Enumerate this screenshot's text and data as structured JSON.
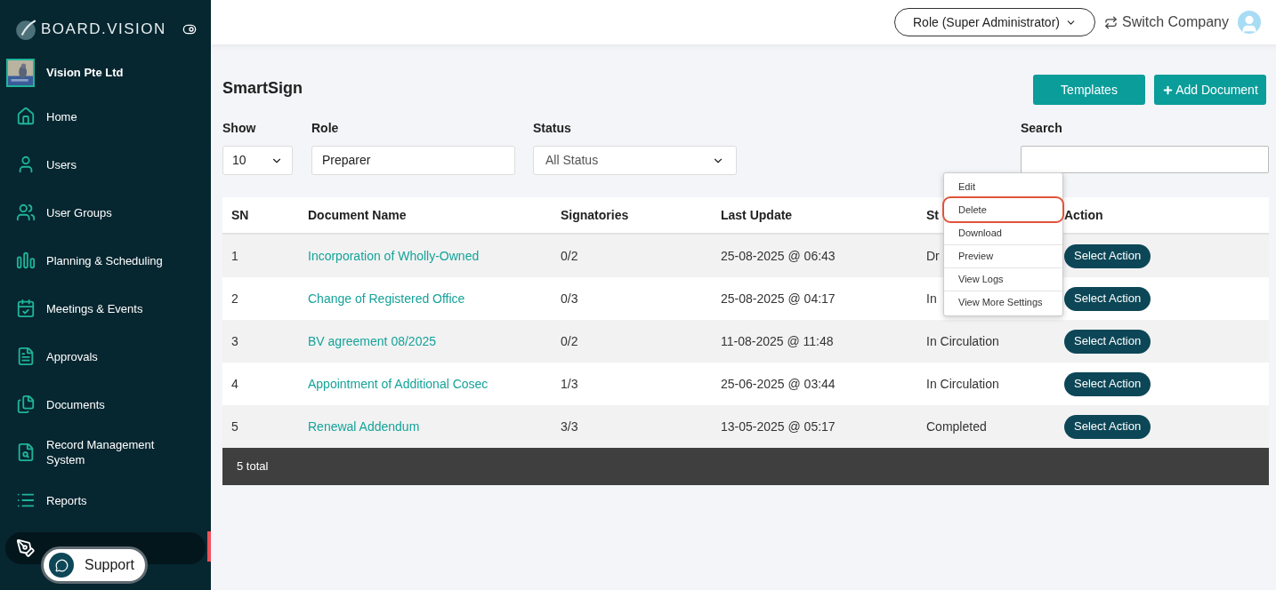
{
  "brand": {
    "name": "BOARD.VISION"
  },
  "company": {
    "name": "Vision Pte Ltd"
  },
  "sidebar": {
    "items": [
      {
        "kind": "home",
        "label": "Home",
        "selected": false
      },
      {
        "kind": "user",
        "label": "Users",
        "selected": false
      },
      {
        "kind": "users",
        "label": "User Groups",
        "selected": false
      },
      {
        "kind": "bars",
        "label": "Planning & Scheduling",
        "selected": false
      },
      {
        "kind": "calendar",
        "label": "Meetings & Events",
        "selected": false
      },
      {
        "kind": "file",
        "label": "Approvals",
        "selected": false
      },
      {
        "kind": "files",
        "label": "Documents",
        "selected": false
      },
      {
        "kind": "record",
        "label": "Record Management System",
        "selected": false
      },
      {
        "kind": "list",
        "label": "Reports",
        "selected": false
      },
      {
        "kind": "pen",
        "selected": true
      }
    ]
  },
  "support": {
    "label": "Support"
  },
  "header": {
    "role": "Role (Super Administrator)",
    "switch": "Switch Company"
  },
  "page": {
    "title": "SmartSign",
    "buttons": [
      {
        "kind": "plain",
        "label": "Templates"
      },
      {
        "kind": "add",
        "label": "Add Document"
      }
    ]
  },
  "filters": {
    "show": {
      "label": "Show",
      "value": "10"
    },
    "role": {
      "label": "Role",
      "value": "Preparer"
    },
    "status": {
      "label": "Status",
      "value": "All Status"
    },
    "search": {
      "label": "Search"
    }
  },
  "table": {
    "columns": [
      "SN",
      "Document Name",
      "Signatories",
      "Last Update",
      "St",
      "Action"
    ],
    "rows": [
      {
        "sn": "1",
        "name": "Incorporation of Wholly-Owned",
        "signatories": "0/2",
        "updated": "25-08-2025 @ 06:43",
        "status": "Dr",
        "action": "Select Action"
      },
      {
        "sn": "2",
        "name": "Change of Registered Office",
        "signatories": "0/3",
        "updated": "25-08-2025 @ 04:17",
        "status": "In",
        "action": "Select Action"
      },
      {
        "sn": "3",
        "name": "BV agreement 08/2025",
        "signatories": "0/2",
        "updated": "11-08-2025 @ 11:48",
        "status": "In Circulation",
        "action": "Select Action"
      },
      {
        "sn": "4",
        "name": "Appointment of Additional Cosec",
        "signatories": "1/3",
        "updated": "25-06-2025 @ 03:44",
        "status": "In Circulation",
        "action": "Select Action"
      },
      {
        "sn": "5",
        "name": "Renewal Addendum",
        "signatories": "3/3",
        "updated": "13-05-2025 @ 05:17",
        "status": "Completed",
        "action": "Select Action"
      }
    ],
    "footer": "5 total"
  },
  "action_menu": {
    "items": [
      {
        "label": "Edit",
        "highlighted": false
      },
      {
        "label": "Delete",
        "highlighted": true
      },
      {
        "label": "Download",
        "highlighted": false
      },
      {
        "label": "Preview",
        "highlighted": false
      },
      {
        "label": "View Logs",
        "highlighted": false
      },
      {
        "label": "View More Settings",
        "highlighted": false
      }
    ]
  }
}
